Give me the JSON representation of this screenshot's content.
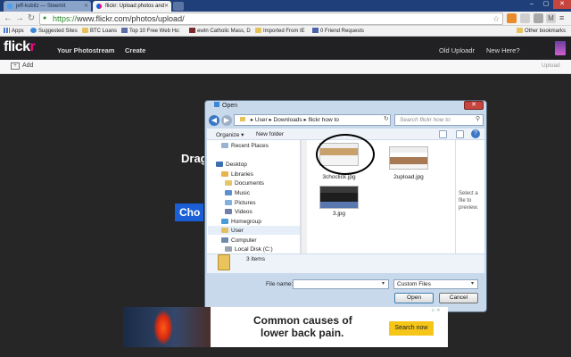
{
  "browser": {
    "tabs": [
      {
        "label": "jeff-kubitz — Steemit",
        "favicon_color": "#4ba2f2"
      },
      {
        "label": "flickr: Upload photos and",
        "favicon_color": "#ff0084"
      }
    ],
    "url_scheme": "https://",
    "url_rest": "www.flickr.com/photos/upload/",
    "bookmarks": [
      {
        "label": "Apps",
        "icon": "apps-grid-icon"
      },
      {
        "label": "Suggested Sites",
        "icon": "ie-icon"
      },
      {
        "label": "BTC Loans",
        "icon": "folder-icon"
      },
      {
        "label": "Top 10 Free Web Ho:",
        "icon": "page-icon"
      },
      {
        "label": "ewtn Catholic Mass, D",
        "icon": "page-icon"
      },
      {
        "label": "Imported From IE",
        "icon": "folder-icon"
      },
      {
        "label": "0 Friend Requests",
        "icon": "page-icon"
      }
    ],
    "other_bookmarks": "Other bookmarks"
  },
  "flickr": {
    "logo_part1": "flick",
    "logo_part2": "r",
    "nav_left": [
      "Your Photostream",
      "Create"
    ],
    "nav_right": [
      "Old Uploadr",
      "New Here?"
    ],
    "add_label": "Add",
    "upload_label": "Upload",
    "drag_text": "Drag",
    "choose_text": "Cho"
  },
  "dialog": {
    "title": "Open",
    "close": "✕",
    "path": [
      "User",
      "Downloads",
      "flickr how to"
    ],
    "search_placeholder": "Search flickr how to",
    "organize": "Organize ▾",
    "new_folder": "New folder",
    "nav_items": [
      {
        "label": "Recent Places",
        "indent": 1,
        "icon_color": "#9bb3d3"
      },
      {
        "label": "Desktop",
        "indent": 0,
        "icon_color": "#3a6fb0"
      },
      {
        "label": "Libraries",
        "indent": 1,
        "icon_color": "#e5b54b"
      },
      {
        "label": "Documents",
        "indent": 2,
        "icon_color": "#e5c76b"
      },
      {
        "label": "Music",
        "indent": 2,
        "icon_color": "#5a8fd0"
      },
      {
        "label": "Pictures",
        "indent": 2,
        "icon_color": "#7fb0e0"
      },
      {
        "label": "Videos",
        "indent": 2,
        "icon_color": "#6f7fa8"
      },
      {
        "label": "Homegroup",
        "indent": 1,
        "icon_color": "#4a9ad6"
      },
      {
        "label": "User",
        "indent": 1,
        "icon_color": "#e2c060"
      },
      {
        "label": "Computer",
        "indent": 1,
        "icon_color": "#6d8aa8"
      },
      {
        "label": "Local Disk (C:)",
        "indent": 2,
        "icon_color": "#9aa4ae"
      }
    ],
    "files": [
      {
        "name": "3choclick.jpg"
      },
      {
        "name": "2upload.jpg"
      },
      {
        "name": "3.jpg"
      }
    ],
    "preview_text": "Select a file to preview.",
    "count_text": "3 items",
    "filename_label": "File name:",
    "filename_value": "",
    "filter_value": "Custom Files",
    "open_label": "Open",
    "cancel_label": "Cancel"
  },
  "ad": {
    "line1": "Common causes of",
    "line2": "lower back pain.",
    "button": "Search now",
    "choices": "▷ ✕"
  }
}
